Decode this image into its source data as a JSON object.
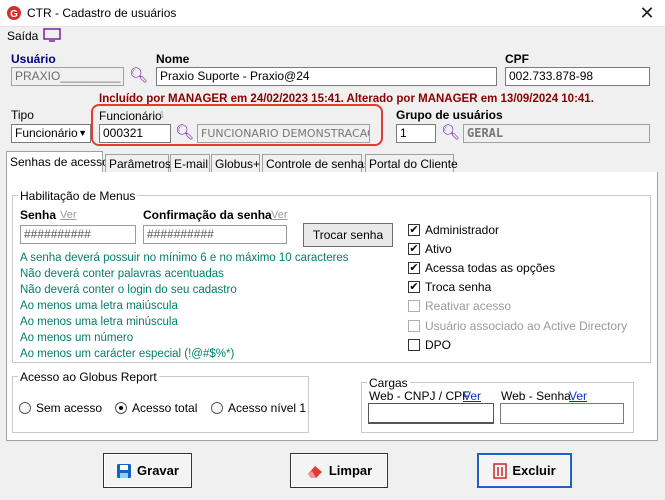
{
  "window": {
    "title": "CTR - Cadastro de usuários",
    "close": "✕"
  },
  "menu": {
    "saida": "Saída"
  },
  "usuario": {
    "label": "Usuário",
    "value": "PRAXIO_________"
  },
  "nome": {
    "label": "Nome",
    "value": "Praxio Suporte - Praxio@24"
  },
  "cpf": {
    "label": "CPF",
    "value": "002.733.878-98"
  },
  "audit": {
    "text": "Incluído por MANAGER em 24/02/2023 15:41. Alterado por MANAGER em 13/09/2024 10:41."
  },
  "tipo": {
    "label": "Tipo",
    "value": "Funcionário"
  },
  "funcionario": {
    "label": "Funcionário",
    "code": "000321",
    "name": "FUNCIONARIO DEMONSTRACAO"
  },
  "grupo": {
    "label": "Grupo de usuários",
    "code": "1",
    "name": "GERAL"
  },
  "tabs": [
    "Senhas de acesso",
    "Parâmetros",
    "E-mail",
    "Globus+",
    "Controle de senhas",
    "Portal do Cliente"
  ],
  "habilitacao": {
    "group_label": "Habilitação de Menus",
    "senha_label": "Senha",
    "senha_ver": "Ver",
    "senha_value": "##########",
    "conf_label": "Confirmação da senha",
    "conf_ver": "Ver",
    "conf_value": "##########",
    "trocar": "Trocar senha",
    "rules": [
      "A senha deverá possuir no mínimo 6 e no máximo 10 caracteres",
      "Não deverá conter palavras acentuadas",
      "Não deverá conter o login do seu cadastro",
      "Ao menos uma letra maiúscula",
      "Ao menos uma letra minúscula",
      "Ao menos um número",
      "Ao menos um carácter especial (!@#$%*)"
    ]
  },
  "checks": [
    {
      "label": "Administrador",
      "checked": true,
      "enabled": true
    },
    {
      "label": "Ativo",
      "checked": true,
      "enabled": true
    },
    {
      "label": "Acessa todas as opções",
      "checked": true,
      "enabled": true
    },
    {
      "label": "Troca senha",
      "checked": true,
      "enabled": true
    },
    {
      "label": "Reativar acesso",
      "checked": false,
      "enabled": false
    },
    {
      "label": "Usuário associado ao Active Directory",
      "checked": false,
      "enabled": false
    },
    {
      "label": "DPO",
      "checked": false,
      "enabled": true
    }
  ],
  "globus_report": {
    "group_label": "Acesso ao Globus Report",
    "options": [
      "Sem acesso",
      "Acesso total",
      "Acesso nível 1"
    ],
    "selected": "Acesso total"
  },
  "cargas": {
    "group_label": "Cargas",
    "cnpj_label": "Web - CNPJ / CPF",
    "cnpj_ver": "Ver",
    "senha_label": "Web - Senha",
    "senha_ver": "Ver"
  },
  "buttons": {
    "gravar": "Gravar",
    "limpar": "Limpar",
    "excluir": "Excluir"
  },
  "colors": {
    "accent": "#000080",
    "audit": "#8b0000",
    "rules": "#00806e",
    "highlight": "#e53935",
    "icon": "#7b1fa2"
  }
}
